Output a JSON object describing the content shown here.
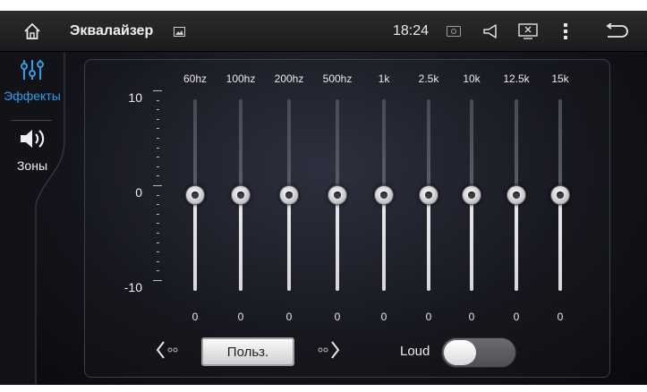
{
  "statusbar": {
    "title": "Эквалайзер",
    "time": "18:24",
    "icons": [
      "home-icon",
      "gallery-icon",
      "cast-icon",
      "volume-icon",
      "screen-close-icon",
      "menu-dots-icon",
      "back-icon"
    ]
  },
  "sidebar": {
    "items": [
      {
        "label": "Эффекты",
        "icon": "equalizer-sliders-icon",
        "active": true
      },
      {
        "label": "Зоны",
        "icon": "speaker-icon",
        "active": false
      }
    ]
  },
  "equalizer": {
    "scale": {
      "max": "10",
      "mid": "0",
      "min": "-10"
    },
    "bands": [
      {
        "freq": "60hz",
        "value": "0"
      },
      {
        "freq": "100hz",
        "value": "0"
      },
      {
        "freq": "200hz",
        "value": "0"
      },
      {
        "freq": "500hz",
        "value": "0"
      },
      {
        "freq": "1k",
        "value": "0"
      },
      {
        "freq": "2.5k",
        "value": "0"
      },
      {
        "freq": "10k",
        "value": "0"
      },
      {
        "freq": "12.5k",
        "value": "0"
      },
      {
        "freq": "15k",
        "value": "0"
      }
    ]
  },
  "controls": {
    "preset_label": "Польз.",
    "loud_label": "Loud",
    "loud_on": false
  },
  "colors": {
    "accent": "#2f9dea"
  }
}
